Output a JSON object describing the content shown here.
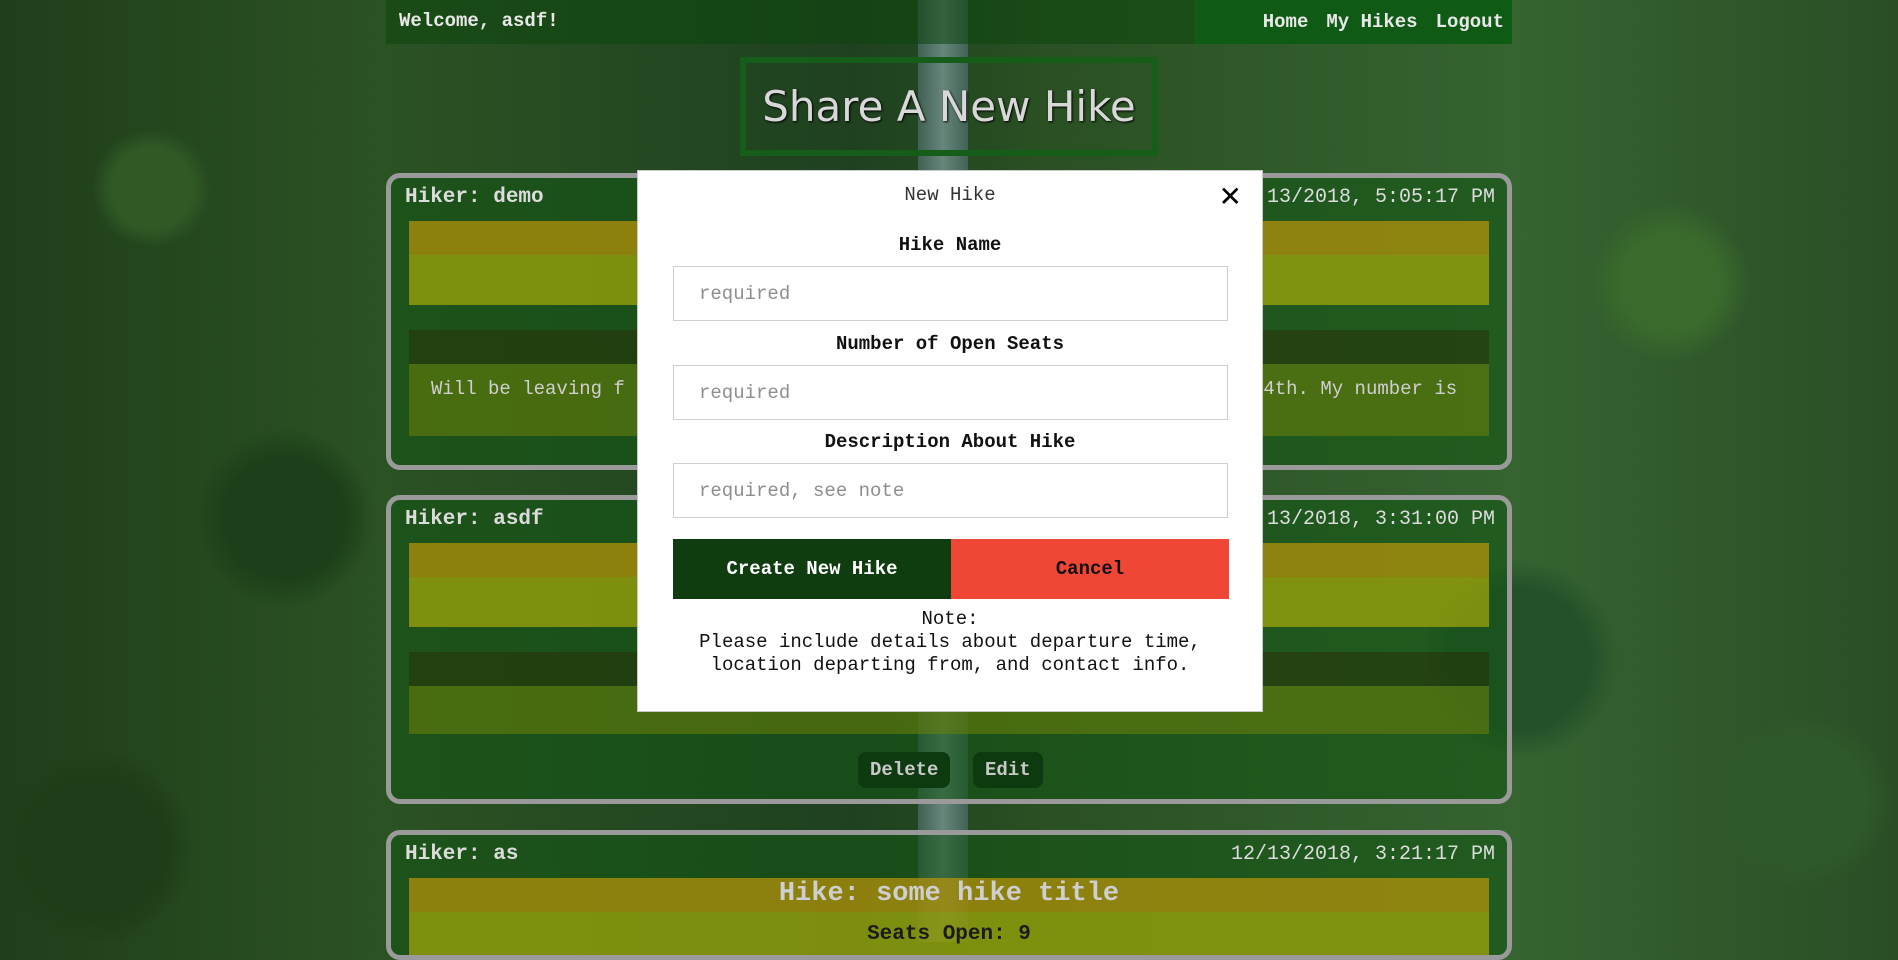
{
  "header": {
    "welcome": "Welcome, asdf!",
    "nav": [
      "Home",
      "My Hikes",
      "Logout"
    ]
  },
  "share_button": "Share A New Hike",
  "posts": [
    {
      "hiker": "Hiker: demo",
      "timestamp": "13/2018, 5:05:17 PM",
      "description": "Will be leaving f                                                        4th. My number is"
    },
    {
      "hiker": "Hiker: asdf",
      "timestamp": "13/2018, 3:31:00 PM",
      "actions": [
        "Delete",
        "Edit"
      ]
    },
    {
      "hiker": "Hiker: as",
      "timestamp": "12/13/2018, 3:21:17 PM",
      "title": "Hike: some hike title",
      "seats": "Seats Open: 9"
    }
  ],
  "modal": {
    "title": "New Hike",
    "close_glyph": "✕",
    "fields": [
      {
        "label": "Hike Name",
        "placeholder": "required"
      },
      {
        "label": "Number of Open Seats",
        "placeholder": "required"
      },
      {
        "label": "Description About Hike",
        "placeholder": "required, see note"
      }
    ],
    "create_label": "Create New Hike",
    "cancel_label": "Cancel",
    "note_heading": "Note:",
    "note_line1": "Please include details about departure time,",
    "note_line2": "location departing from, and contact info."
  },
  "colors": {
    "nav_bg": "#0f5a14",
    "create_bg": "#0f3d10",
    "cancel_bg": "#f04636"
  }
}
